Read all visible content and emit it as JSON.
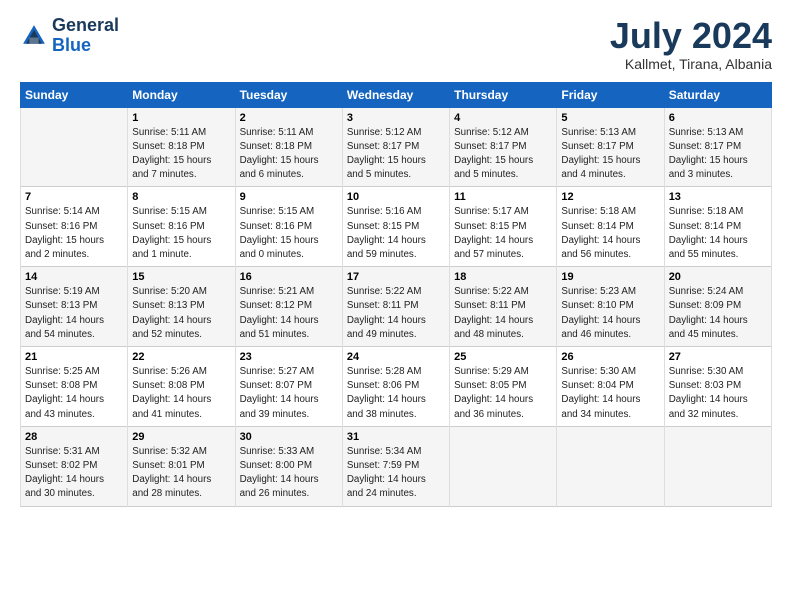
{
  "header": {
    "logo_general": "General",
    "logo_blue": "Blue",
    "month_title": "July 2024",
    "location": "Kallmet, Tirana, Albania"
  },
  "days_of_week": [
    "Sunday",
    "Monday",
    "Tuesday",
    "Wednesday",
    "Thursday",
    "Friday",
    "Saturday"
  ],
  "weeks": [
    [
      {
        "day": "",
        "info": ""
      },
      {
        "day": "1",
        "info": "Sunrise: 5:11 AM\nSunset: 8:18 PM\nDaylight: 15 hours\nand 7 minutes."
      },
      {
        "day": "2",
        "info": "Sunrise: 5:11 AM\nSunset: 8:18 PM\nDaylight: 15 hours\nand 6 minutes."
      },
      {
        "day": "3",
        "info": "Sunrise: 5:12 AM\nSunset: 8:17 PM\nDaylight: 15 hours\nand 5 minutes."
      },
      {
        "day": "4",
        "info": "Sunrise: 5:12 AM\nSunset: 8:17 PM\nDaylight: 15 hours\nand 5 minutes."
      },
      {
        "day": "5",
        "info": "Sunrise: 5:13 AM\nSunset: 8:17 PM\nDaylight: 15 hours\nand 4 minutes."
      },
      {
        "day": "6",
        "info": "Sunrise: 5:13 AM\nSunset: 8:17 PM\nDaylight: 15 hours\nand 3 minutes."
      }
    ],
    [
      {
        "day": "7",
        "info": "Sunrise: 5:14 AM\nSunset: 8:16 PM\nDaylight: 15 hours\nand 2 minutes."
      },
      {
        "day": "8",
        "info": "Sunrise: 5:15 AM\nSunset: 8:16 PM\nDaylight: 15 hours\nand 1 minute."
      },
      {
        "day": "9",
        "info": "Sunrise: 5:15 AM\nSunset: 8:16 PM\nDaylight: 15 hours\nand 0 minutes."
      },
      {
        "day": "10",
        "info": "Sunrise: 5:16 AM\nSunset: 8:15 PM\nDaylight: 14 hours\nand 59 minutes."
      },
      {
        "day": "11",
        "info": "Sunrise: 5:17 AM\nSunset: 8:15 PM\nDaylight: 14 hours\nand 57 minutes."
      },
      {
        "day": "12",
        "info": "Sunrise: 5:18 AM\nSunset: 8:14 PM\nDaylight: 14 hours\nand 56 minutes."
      },
      {
        "day": "13",
        "info": "Sunrise: 5:18 AM\nSunset: 8:14 PM\nDaylight: 14 hours\nand 55 minutes."
      }
    ],
    [
      {
        "day": "14",
        "info": "Sunrise: 5:19 AM\nSunset: 8:13 PM\nDaylight: 14 hours\nand 54 minutes."
      },
      {
        "day": "15",
        "info": "Sunrise: 5:20 AM\nSunset: 8:13 PM\nDaylight: 14 hours\nand 52 minutes."
      },
      {
        "day": "16",
        "info": "Sunrise: 5:21 AM\nSunset: 8:12 PM\nDaylight: 14 hours\nand 51 minutes."
      },
      {
        "day": "17",
        "info": "Sunrise: 5:22 AM\nSunset: 8:11 PM\nDaylight: 14 hours\nand 49 minutes."
      },
      {
        "day": "18",
        "info": "Sunrise: 5:22 AM\nSunset: 8:11 PM\nDaylight: 14 hours\nand 48 minutes."
      },
      {
        "day": "19",
        "info": "Sunrise: 5:23 AM\nSunset: 8:10 PM\nDaylight: 14 hours\nand 46 minutes."
      },
      {
        "day": "20",
        "info": "Sunrise: 5:24 AM\nSunset: 8:09 PM\nDaylight: 14 hours\nand 45 minutes."
      }
    ],
    [
      {
        "day": "21",
        "info": "Sunrise: 5:25 AM\nSunset: 8:08 PM\nDaylight: 14 hours\nand 43 minutes."
      },
      {
        "day": "22",
        "info": "Sunrise: 5:26 AM\nSunset: 8:08 PM\nDaylight: 14 hours\nand 41 minutes."
      },
      {
        "day": "23",
        "info": "Sunrise: 5:27 AM\nSunset: 8:07 PM\nDaylight: 14 hours\nand 39 minutes."
      },
      {
        "day": "24",
        "info": "Sunrise: 5:28 AM\nSunset: 8:06 PM\nDaylight: 14 hours\nand 38 minutes."
      },
      {
        "day": "25",
        "info": "Sunrise: 5:29 AM\nSunset: 8:05 PM\nDaylight: 14 hours\nand 36 minutes."
      },
      {
        "day": "26",
        "info": "Sunrise: 5:30 AM\nSunset: 8:04 PM\nDaylight: 14 hours\nand 34 minutes."
      },
      {
        "day": "27",
        "info": "Sunrise: 5:30 AM\nSunset: 8:03 PM\nDaylight: 14 hours\nand 32 minutes."
      }
    ],
    [
      {
        "day": "28",
        "info": "Sunrise: 5:31 AM\nSunset: 8:02 PM\nDaylight: 14 hours\nand 30 minutes."
      },
      {
        "day": "29",
        "info": "Sunrise: 5:32 AM\nSunset: 8:01 PM\nDaylight: 14 hours\nand 28 minutes."
      },
      {
        "day": "30",
        "info": "Sunrise: 5:33 AM\nSunset: 8:00 PM\nDaylight: 14 hours\nand 26 minutes."
      },
      {
        "day": "31",
        "info": "Sunrise: 5:34 AM\nSunset: 7:59 PM\nDaylight: 14 hours\nand 24 minutes."
      },
      {
        "day": "",
        "info": ""
      },
      {
        "day": "",
        "info": ""
      },
      {
        "day": "",
        "info": ""
      }
    ]
  ]
}
